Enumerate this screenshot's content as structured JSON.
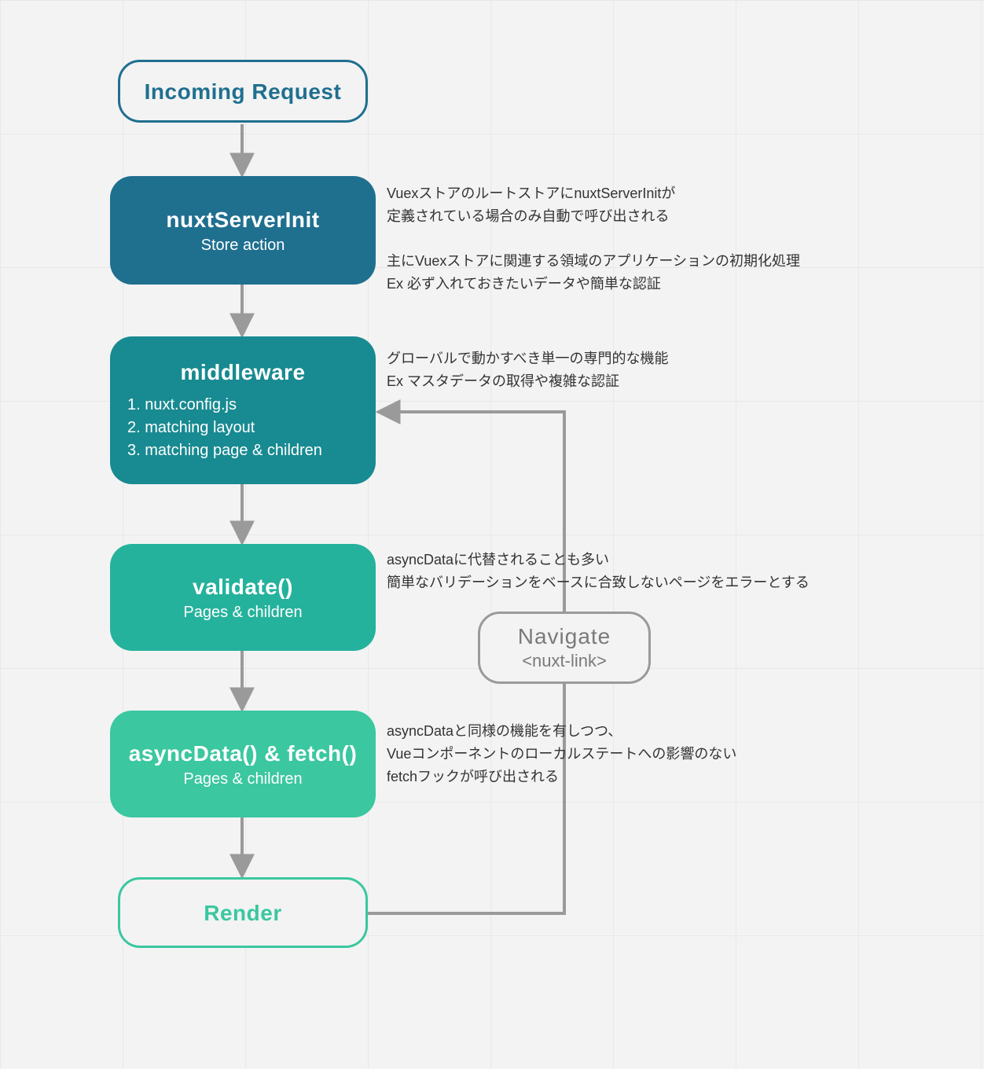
{
  "colors": {
    "c_incoming_border": "#1f6f8f",
    "c_incoming_text": "#1f6f8f",
    "c_serverinit": "#1f6f8f",
    "c_middleware": "#188a91",
    "c_validate": "#25b29c",
    "c_asyncdata": "#3bc7a0",
    "c_render_border": "#3bc7a0",
    "c_render_text": "#3bc7a0",
    "c_arrow": "#9a9a9a"
  },
  "nodes": {
    "incoming": {
      "title": "Incoming Request"
    },
    "serverinit": {
      "title": "nuxtServerInit",
      "sub": "Store action"
    },
    "middleware": {
      "title": "middleware",
      "list": "1. nuxt.config.js\n2. matching layout\n3. matching page & children"
    },
    "validate": {
      "title": "validate()",
      "sub": "Pages & children"
    },
    "asyncdata": {
      "title": "asyncData() & fetch()",
      "sub": "Pages & children"
    },
    "render": {
      "title": "Render"
    },
    "navigate": {
      "title": "Navigate",
      "sub": "<nuxt-link>"
    }
  },
  "annotations": {
    "serverinit": "VuexストアのルートストアにnuxtServerInitが\n定義されている場合のみ自動で呼び出される\n\n主にVuexストアに関連する領域のアプリケーションの初期化処理\nEx 必ず入れておきたいデータや簡単な認証",
    "middleware": "グローバルで動かすべき単一の専門的な機能\nEx マスタデータの取得や複雑な認証",
    "validate": "asyncDataに代替されることも多い\n簡単なバリデーションをベースに合致しないページをエラーとする",
    "asyncdata": "asyncDataと同様の機能を有しつつ、\nVueコンポーネントのローカルステートへの影響のない\nfetchフックが呼び出される"
  }
}
